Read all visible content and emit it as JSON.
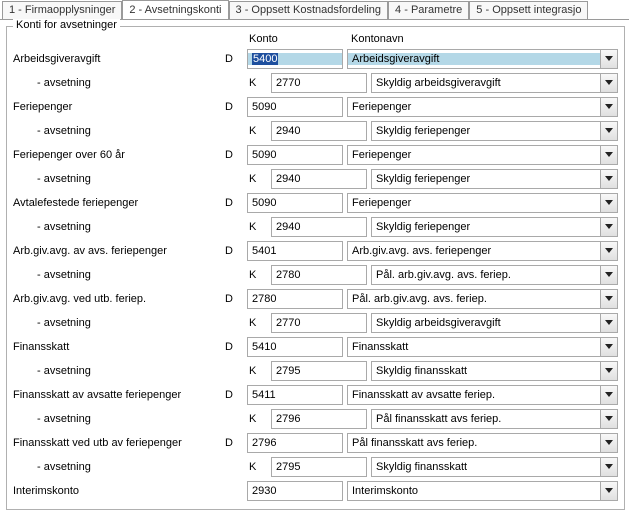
{
  "tabs": [
    {
      "label": "1 - Firmaopplysninger",
      "active": false
    },
    {
      "label": "2 - Avsetningskonti",
      "active": true
    },
    {
      "label": "3 - Oppsett Kostnadsfordeling",
      "active": false
    },
    {
      "label": "4 - Parametre",
      "active": false
    },
    {
      "label": "5 - Oppsett integrasjo",
      "active": false
    }
  ],
  "group_title": "Konti for avsetninger",
  "headers": {
    "konto": "Konto",
    "kontonavn": "Kontonavn"
  },
  "rows": [
    {
      "label": "Arbeidsgiveravgift",
      "indent": false,
      "dk": "D",
      "konto": "5400",
      "navn": "Arbeidsgiveravgift",
      "selected": true
    },
    {
      "label": "- avsetning",
      "indent": true,
      "dk": "K",
      "konto": "2770",
      "navn": "Skyldig arbeidsgiveravgift",
      "selected": false
    },
    {
      "label": "Feriepenger",
      "indent": false,
      "dk": "D",
      "konto": "5090",
      "navn": "Feriepenger",
      "selected": false
    },
    {
      "label": "- avsetning",
      "indent": true,
      "dk": "K",
      "konto": "2940",
      "navn": "Skyldig feriepenger",
      "selected": false
    },
    {
      "label": "Feriepenger over 60 år",
      "indent": false,
      "dk": "D",
      "konto": "5090",
      "navn": "Feriepenger",
      "selected": false
    },
    {
      "label": "- avsetning",
      "indent": true,
      "dk": "K",
      "konto": "2940",
      "navn": "Skyldig feriepenger",
      "selected": false
    },
    {
      "label": "Avtalefestede feriepenger",
      "indent": false,
      "dk": "D",
      "konto": "5090",
      "navn": "Feriepenger",
      "selected": false
    },
    {
      "label": "- avsetning",
      "indent": true,
      "dk": "K",
      "konto": "2940",
      "navn": "Skyldig feriepenger",
      "selected": false
    },
    {
      "label": "Arb.giv.avg. av avs. feriepenger",
      "indent": false,
      "dk": "D",
      "konto": "5401",
      "navn": "Arb.giv.avg. avs. feriepenger",
      "selected": false
    },
    {
      "label": "- avsetning",
      "indent": true,
      "dk": "K",
      "konto": "2780",
      "navn": "Pål. arb.giv.avg. avs. feriep.",
      "selected": false
    },
    {
      "label": "Arb.giv.avg. ved utb. feriep.",
      "indent": false,
      "dk": "D",
      "konto": "2780",
      "navn": "Pål. arb.giv.avg. avs. feriep.",
      "selected": false
    },
    {
      "label": "- avsetning",
      "indent": true,
      "dk": "K",
      "konto": "2770",
      "navn": "Skyldig arbeidsgiveravgift",
      "selected": false
    },
    {
      "label": "Finansskatt",
      "indent": false,
      "dk": "D",
      "konto": "5410",
      "navn": "Finansskatt",
      "selected": false
    },
    {
      "label": "- avsetning",
      "indent": true,
      "dk": "K",
      "konto": "2795",
      "navn": "Skyldig finansskatt",
      "selected": false
    },
    {
      "label": "Finansskatt av avsatte feriepenger",
      "indent": false,
      "dk": "D",
      "konto": "5411",
      "navn": "Finansskatt av avsatte feriep.",
      "selected": false
    },
    {
      "label": "- avsetning",
      "indent": true,
      "dk": "K",
      "konto": "2796",
      "navn": "Pål finansskatt avs feriep.",
      "selected": false
    },
    {
      "label": "Finansskatt ved utb av feriepenger",
      "indent": false,
      "dk": "D",
      "konto": "2796",
      "navn": "Pål finansskatt avs feriep.",
      "selected": false
    },
    {
      "label": "- avsetning",
      "indent": true,
      "dk": "K",
      "konto": "2795",
      "navn": "Skyldig finansskatt",
      "selected": false
    },
    {
      "label": "Interimskonto",
      "indent": false,
      "dk": "",
      "konto": "2930",
      "navn": "Interimskonto",
      "selected": false
    }
  ]
}
